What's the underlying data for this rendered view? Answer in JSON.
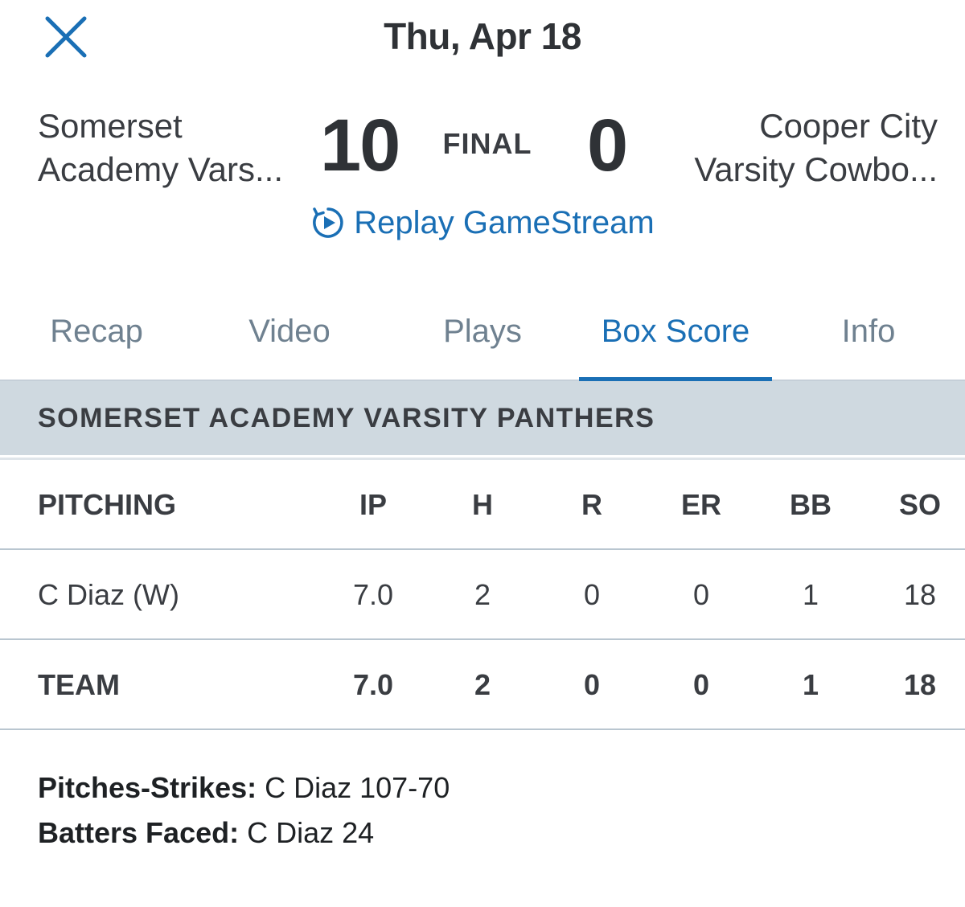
{
  "header": {
    "date": "Thu, Apr 18",
    "close_icon": "close-icon"
  },
  "scoreboard": {
    "home_team_line1": "Somerset",
    "home_team_line2": "Academy Vars...",
    "home_score": "10",
    "status": "FINAL",
    "away_score": "0",
    "away_team_line1": "Cooper City",
    "away_team_line2": "Varsity Cowbo...",
    "replay_label": "Replay GameStream",
    "replay_icon": "replay-icon"
  },
  "tabs": [
    {
      "label": "Recap",
      "active": false
    },
    {
      "label": "Video",
      "active": false
    },
    {
      "label": "Plays",
      "active": false
    },
    {
      "label": "Box Score",
      "active": true
    },
    {
      "label": "Info",
      "active": false
    }
  ],
  "team_section": {
    "title": "SOMERSET ACADEMY VARSITY PANTHERS"
  },
  "pitching_table": {
    "headers": [
      "PITCHING",
      "IP",
      "H",
      "R",
      "ER",
      "BB",
      "SO"
    ],
    "rows": [
      [
        "C Diaz (W)",
        "7.0",
        "2",
        "0",
        "0",
        "1",
        "18"
      ]
    ],
    "total": [
      "TEAM",
      "7.0",
      "2",
      "0",
      "0",
      "1",
      "18"
    ]
  },
  "notes": {
    "pitches_label": "Pitches-Strikes:",
    "pitches_value": " C Diaz 107-70",
    "batters_label": "Batters Faced:",
    "batters_value": " C Diaz 24"
  },
  "colors": {
    "accent": "#1a6fb5",
    "band": "#cfd9e0",
    "inactive_tab": "#6f8190"
  }
}
